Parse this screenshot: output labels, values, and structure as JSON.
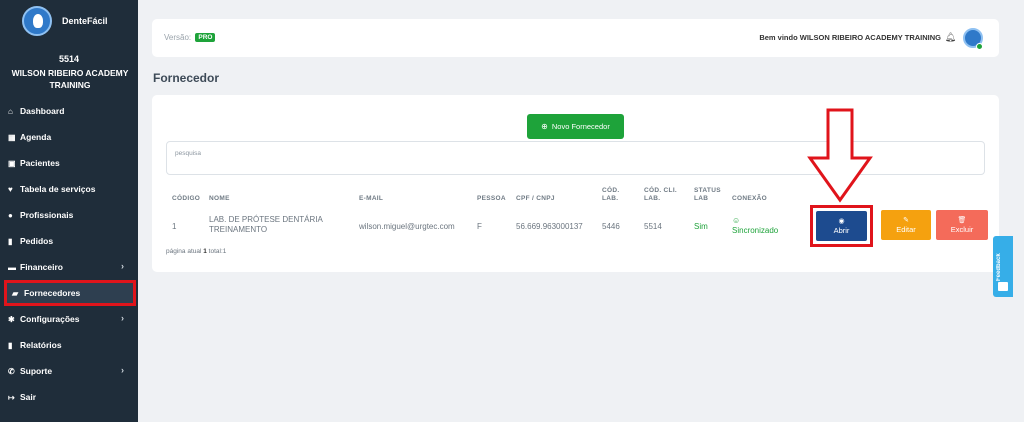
{
  "brand": {
    "name": "DenteFácil"
  },
  "user": {
    "code": "5514",
    "name": "WILSON RIBEIRO ACADEMY TRAINING"
  },
  "sidebar": {
    "items": [
      {
        "label": "Dashboard",
        "icon": "home-icon"
      },
      {
        "label": "Agenda",
        "icon": "calendar-icon"
      },
      {
        "label": "Pacientes",
        "icon": "id-card-icon"
      },
      {
        "label": "Tabela de serviços",
        "icon": "tooth-icon"
      },
      {
        "label": "Profissionais",
        "icon": "user-icon"
      },
      {
        "label": "Pedidos",
        "icon": "file-icon"
      },
      {
        "label": "Financeiro",
        "icon": "money-icon",
        "has_submenu": true
      },
      {
        "label": "Fornecedores",
        "icon": "truck-icon",
        "active": true
      },
      {
        "label": "Configurações",
        "icon": "gear-icon",
        "has_submenu": true
      },
      {
        "label": "Relatórios",
        "icon": "report-icon"
      },
      {
        "label": "Suporte",
        "icon": "phone-icon",
        "has_submenu": true
      },
      {
        "label": "Sair",
        "icon": "sign-out-icon"
      }
    ]
  },
  "topbar": {
    "version_label": "Versão:",
    "version_badge": "PRO",
    "welcome": "Bem vindo WILSON RIBEIRO ACADEMY TRAINING"
  },
  "page": {
    "title": "Fornecedor"
  },
  "actions": {
    "new_label": "Novo Fornecedor"
  },
  "search": {
    "placeholder": "pesquisa"
  },
  "table": {
    "headers": {
      "codigo": "CÓDIGO",
      "nome": "NOME",
      "email": "E-MAIL",
      "pessoa": "PESSOA",
      "cpf": "CPF / CNPJ",
      "cod_lab": "CÓD. LAB.",
      "cod_cli_lab": "CÓD. CLI. LAB.",
      "status_lab": "STATUS LAB",
      "conexao": "CONEXÃO"
    },
    "rows": [
      {
        "codigo": "1",
        "nome": "LAB. DE PRÓTESE DENTÁRIA TREINAMENTO",
        "email": "wilson.miguel@urgtec.com",
        "pessoa": "F",
        "cpf": "56.669.963000137",
        "cod_lab": "5446",
        "cod_cli_lab": "5514",
        "status_lab": "Sim",
        "conexao": "Sincronizado",
        "open_label": "Abrir",
        "edit_label": "Editar",
        "delete_label": "Excluir"
      }
    ]
  },
  "pagination": {
    "prefix": "página atual",
    "current": "1",
    "total_text": "total:1"
  },
  "feedback": {
    "label": "Feedback"
  },
  "colors": {
    "sidebar_bg": "#1f2d3a",
    "primary_green": "#1ea33a",
    "open_blue": "#1d4b8f",
    "edit_orange": "#f5a10f",
    "delete_red": "#f46b5a",
    "highlight_red": "#e0141b",
    "feedback_blue": "#36aee8"
  }
}
